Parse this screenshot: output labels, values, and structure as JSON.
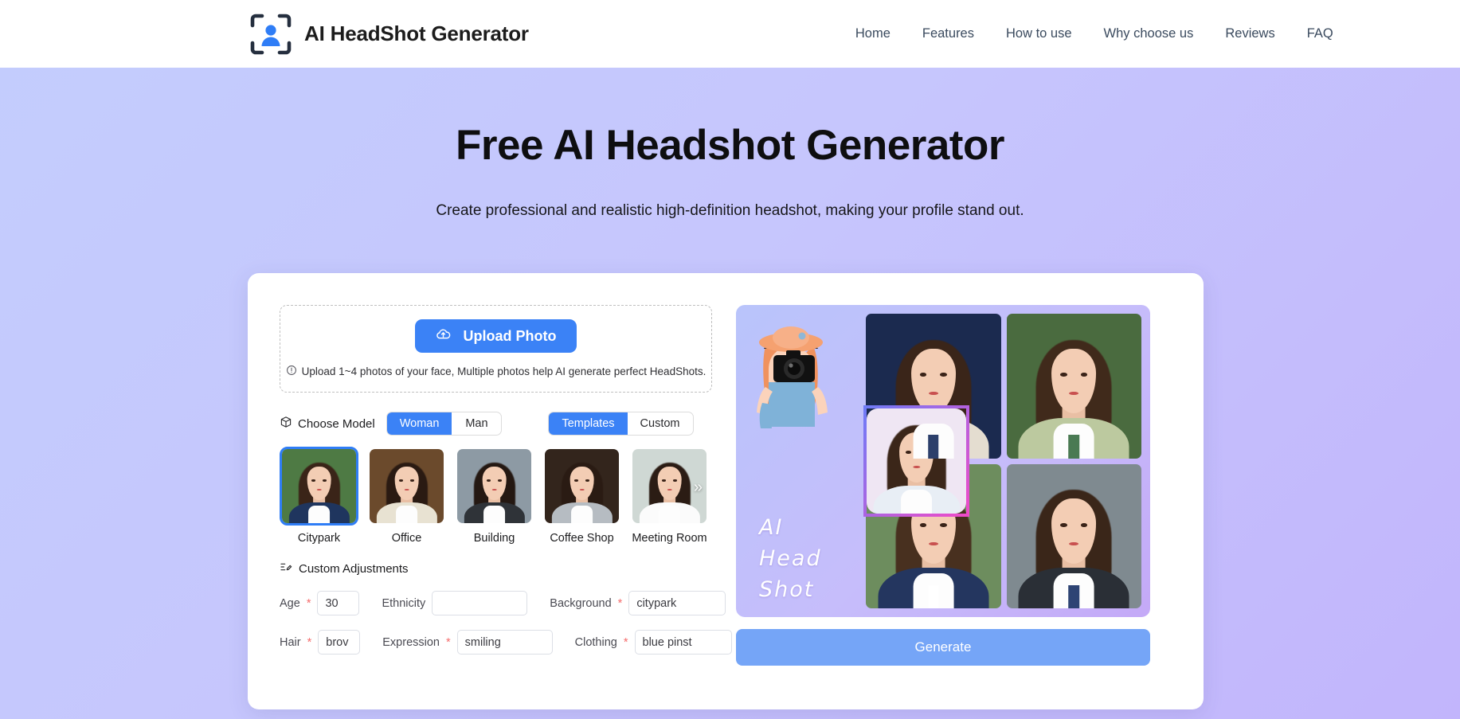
{
  "header": {
    "logo_icon": "person-in-frame-icon",
    "brand_title": "AI HeadShot Generator",
    "nav": [
      {
        "label": "Home"
      },
      {
        "label": "Features"
      },
      {
        "label": "How to use"
      },
      {
        "label": "Why choose us"
      },
      {
        "label": "Reviews"
      },
      {
        "label": "FAQ"
      }
    ]
  },
  "hero": {
    "title": "Free AI Headshot Generator",
    "subtitle": "Create professional and realistic high-definition headshot, making your profile stand out."
  },
  "upload": {
    "button_label": "Upload Photo",
    "button_icon": "cloud-upload-icon",
    "hint_icon": "info-circle-icon",
    "hint": "Upload 1~4 photos of your face, Multiple photos help AI generate perfect HeadShots."
  },
  "model": {
    "label": "Choose Model",
    "label_icon": "cube-icon",
    "gender_options": [
      "Woman",
      "Man"
    ],
    "gender_selected": "Woman",
    "source_options": [
      "Templates",
      "Custom"
    ],
    "source_selected": "Templates"
  },
  "templates": {
    "next_icon": "chevron-double-right-icon",
    "selected": "Citypark",
    "items": [
      {
        "label": "Citypark",
        "bg": "#4e7a44",
        "suit": "#1f355e",
        "hair": "#3a2418"
      },
      {
        "label": "Office",
        "bg": "#6b4a2c",
        "suit": "#e8e2d2",
        "hair": "#2a1a12"
      },
      {
        "label": "Building",
        "bg": "#8d9aa4",
        "suit": "#2f3338",
        "hair": "#241812"
      },
      {
        "label": "Coffee Shop",
        "bg": "#33251c",
        "suit": "#b6bcc2",
        "hair": "#2a1b13"
      },
      {
        "label": "Meeting Room",
        "bg": "#cfd8d4",
        "suit": "#fbfbfb",
        "hair": "#2b1c14"
      }
    ]
  },
  "adjustments": {
    "title": "Custom Adjustments",
    "title_icon": "edit-list-icon",
    "fields": [
      {
        "label": "Age",
        "required": true,
        "value": "30",
        "placeholder": "",
        "size": "sm"
      },
      {
        "label": "Ethnicity",
        "required": false,
        "value": "",
        "placeholder": "",
        "size": "md"
      },
      {
        "label": "Background",
        "required": true,
        "value": "citypark",
        "placeholder": "",
        "size": "lg"
      },
      {
        "label": "Hair",
        "required": true,
        "value": "brov",
        "placeholder": "",
        "size": "sm"
      },
      {
        "label": "Expression",
        "required": true,
        "value": "smiling",
        "placeholder": "",
        "size": "md"
      },
      {
        "label": "Clothing",
        "required": true,
        "value": "blue pinst",
        "placeholder": "",
        "size": "lg"
      }
    ]
  },
  "preview": {
    "word_art": "AI\nHead\nShot",
    "mascot_icon": "photographer-illustration",
    "cells": [
      {
        "name": "navy-backdrop-portrait",
        "bg": "#1b2a4f",
        "suit": "#e4ddd0",
        "tie": "#2c3f6b",
        "hair": "#3a2519"
      },
      {
        "name": "green-backdrop-portrait",
        "bg": "#4a6b3f",
        "suit": "#bcc99f",
        "tie": "#4a7a53",
        "hair": "#402a1b"
      },
      {
        "name": "park-backdrop-portrait",
        "bg": "#6d8d5e",
        "suit": "#24365f",
        "tie": "#ffffff",
        "hair": "#48301f"
      },
      {
        "name": "office-backdrop-portrait",
        "bg": "#7f8a90",
        "suit": "#2a2f36",
        "tie": "#2e4474",
        "hair": "#3a2619"
      }
    ],
    "highlight": {
      "name": "selected-face-frame",
      "gradient_from": "#6f7bf7",
      "gradient_to": "#ef4bc8"
    }
  },
  "generate": {
    "label": "Generate"
  },
  "colors": {
    "accent": "#3b82f6",
    "generate_button": "#75a5f7",
    "required_star": "#f56c6c",
    "bg_from": "#c3cdfd",
    "bg_to": "#c2b5fc"
  }
}
